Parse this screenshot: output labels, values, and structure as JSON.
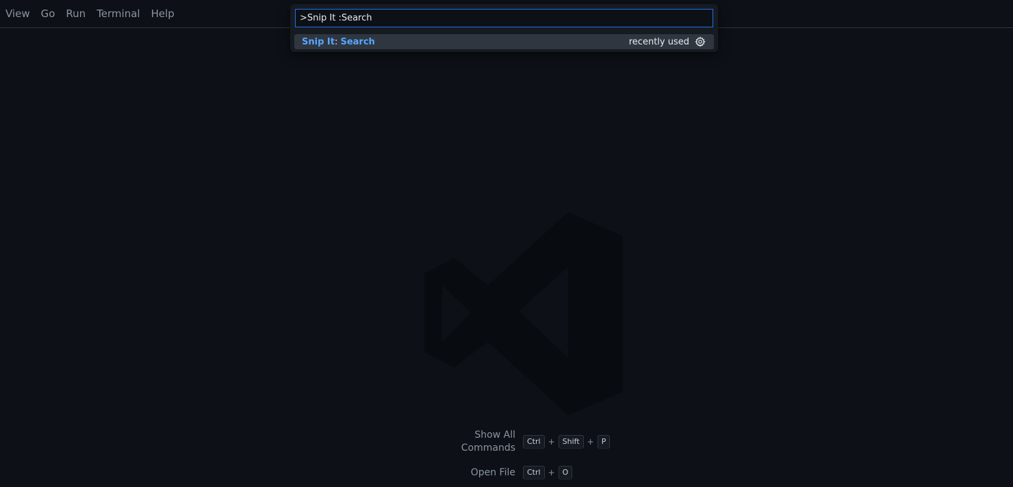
{
  "menubar": {
    "items": [
      "View",
      "Go",
      "Run",
      "Terminal",
      "Help"
    ]
  },
  "palette": {
    "input_value": ">Snip It :Search",
    "result": {
      "prefix": "Snip It",
      "separator": ": ",
      "command": "Search",
      "tag": "recently used",
      "action_icon": "gear-icon"
    }
  },
  "shortcuts": [
    {
      "label": "Show All Commands",
      "keys": [
        "Ctrl",
        "Shift",
        "P"
      ]
    },
    {
      "label": "Open File",
      "keys": [
        "Ctrl",
        "O"
      ]
    }
  ],
  "colors": {
    "background": "#0d1117",
    "accent": "#1f6feb",
    "highlight": "#58a6ff",
    "selected_row": "#2f3640"
  },
  "icons": {
    "watermark": "vscode-logo-icon"
  }
}
